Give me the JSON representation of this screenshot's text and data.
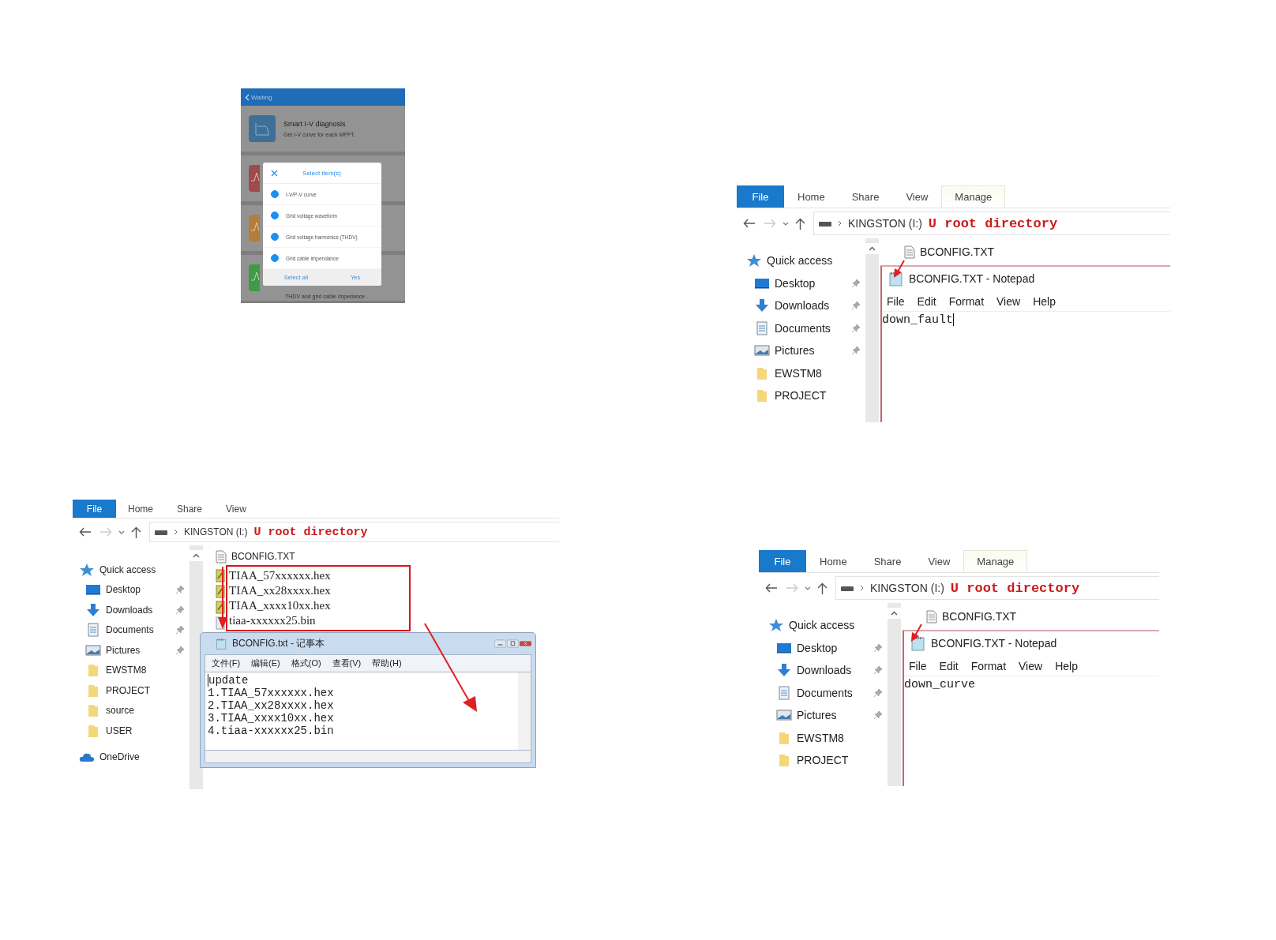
{
  "phone": {
    "back_label": "Waiting",
    "card": {
      "title": "Smart I-V diagnosis",
      "subtitle": "Get I-V curve for each MPPT."
    },
    "bottom_card_subtitle": "THDV and grid cable impedance .",
    "dialog": {
      "title": "Select item(s)",
      "options": [
        {
          "label": "I-V/P-V curve",
          "checked": true
        },
        {
          "label": "Grid voltage waveform",
          "checked": true
        },
        {
          "label": "Grid voltage harmonics (THDV)",
          "checked": true
        },
        {
          "label": "Grid cable impendance",
          "checked": true
        }
      ],
      "buttons": [
        "Select all",
        "Yes"
      ]
    }
  },
  "explorers": [
    {
      "ribbon_tabs": [
        {
          "label": "File",
          "selected": true,
          "kind": "standard"
        },
        {
          "label": "Home",
          "selected": false,
          "kind": "standard"
        },
        {
          "label": "Share",
          "selected": false,
          "kind": "standard"
        },
        {
          "label": "View",
          "selected": false,
          "kind": "standard"
        },
        {
          "label": "Manage",
          "selected": false,
          "kind": "contextual"
        }
      ],
      "path": "KINGSTON (I:)",
      "annotation": "U root directory",
      "nav": [
        {
          "label": "Quick access",
          "kind": "star",
          "pinned": false
        },
        {
          "label": "Desktop",
          "kind": "desktop",
          "pinned": true
        },
        {
          "label": "Downloads",
          "kind": "downloads",
          "pinned": true
        },
        {
          "label": "Documents",
          "kind": "documents",
          "pinned": true
        },
        {
          "label": "Pictures",
          "kind": "pictures",
          "pinned": true
        },
        {
          "label": "EWSTM8",
          "kind": "folder",
          "pinned": false
        },
        {
          "label": "PROJECT",
          "kind": "folder",
          "pinned": false
        }
      ],
      "files": [
        {
          "name": "BCONFIG.TXT",
          "kind": "text"
        }
      ],
      "notepad": {
        "kind": "win10",
        "title": "BCONFIG.TXT - Notepad",
        "menu": [
          "File",
          "Edit",
          "Format",
          "View",
          "Help"
        ],
        "lines": [
          "down_fault"
        ],
        "cursor_at_end": true
      }
    },
    {
      "ribbon_tabs": [
        {
          "label": "File",
          "selected": true,
          "kind": "standard"
        },
        {
          "label": "Home",
          "selected": false,
          "kind": "standard"
        },
        {
          "label": "Share",
          "selected": false,
          "kind": "standard"
        },
        {
          "label": "View",
          "selected": false,
          "kind": "standard"
        }
      ],
      "path": "KINGSTON (I:)",
      "annotation": "U root directory",
      "nav": [
        {
          "label": "Quick access",
          "kind": "star",
          "pinned": false
        },
        {
          "label": "Desktop",
          "kind": "desktop",
          "pinned": true
        },
        {
          "label": "Downloads",
          "kind": "downloads",
          "pinned": true
        },
        {
          "label": "Documents",
          "kind": "documents",
          "pinned": true
        },
        {
          "label": "Pictures",
          "kind": "pictures",
          "pinned": true
        },
        {
          "label": "EWSTM8",
          "kind": "folder",
          "pinned": false
        },
        {
          "label": "PROJECT",
          "kind": "folder",
          "pinned": false
        },
        {
          "label": "source",
          "kind": "folder",
          "pinned": false
        },
        {
          "label": "USER",
          "kind": "folder",
          "pinned": false
        },
        {
          "label": "OneDrive",
          "kind": "cloud",
          "pinned": false
        }
      ],
      "files": [
        {
          "name": "BCONFIG.TXT",
          "kind": "text"
        }
      ],
      "boxed_files": [
        {
          "name": "TIAA_57xxxxxx.hex",
          "kind": "program"
        },
        {
          "name": "TIAA_xx28xxxx.hex",
          "kind": "program"
        },
        {
          "name": "TIAA_xxxx10xx.hex",
          "kind": "program"
        },
        {
          "name": "tiaa-xxxxxx25.bin",
          "kind": "binary"
        }
      ],
      "notepad": {
        "kind": "win7",
        "title": "BCONFIG.txt - 记事本",
        "menu": [
          "文件(F)",
          "编辑(E)",
          "格式(O)",
          "查看(V)",
          "帮助(H)"
        ],
        "lines": [
          "update",
          "1.TIAA_57xxxxxx.hex",
          "2.TIAA_xx28xxxx.hex",
          "3.TIAA_xxxx10xx.hex",
          "4.tiaa-xxxxxx25.bin"
        ],
        "cursor_at_end": false
      }
    },
    {
      "ribbon_tabs": [
        {
          "label": "File",
          "selected": true,
          "kind": "standard"
        },
        {
          "label": "Home",
          "selected": false,
          "kind": "standard"
        },
        {
          "label": "Share",
          "selected": false,
          "kind": "standard"
        },
        {
          "label": "View",
          "selected": false,
          "kind": "standard"
        },
        {
          "label": "Manage",
          "selected": false,
          "kind": "contextual"
        }
      ],
      "path": "KINGSTON (I:)",
      "annotation": "U root directory",
      "nav": [
        {
          "label": "Quick access",
          "kind": "star",
          "pinned": false
        },
        {
          "label": "Desktop",
          "kind": "desktop",
          "pinned": true
        },
        {
          "label": "Downloads",
          "kind": "downloads",
          "pinned": true
        },
        {
          "label": "Documents",
          "kind": "documents",
          "pinned": true
        },
        {
          "label": "Pictures",
          "kind": "pictures",
          "pinned": true
        },
        {
          "label": "EWSTM8",
          "kind": "folder",
          "pinned": false
        },
        {
          "label": "PROJECT",
          "kind": "folder",
          "pinned": false
        }
      ],
      "files": [
        {
          "name": "BCONFIG.TXT",
          "kind": "text"
        }
      ],
      "notepad": {
        "kind": "win10",
        "title": "BCONFIG.TXT - Notepad",
        "menu": [
          "File",
          "Edit",
          "Format",
          "View",
          "Help"
        ],
        "lines": [
          "down_curve"
        ]
      }
    }
  ]
}
